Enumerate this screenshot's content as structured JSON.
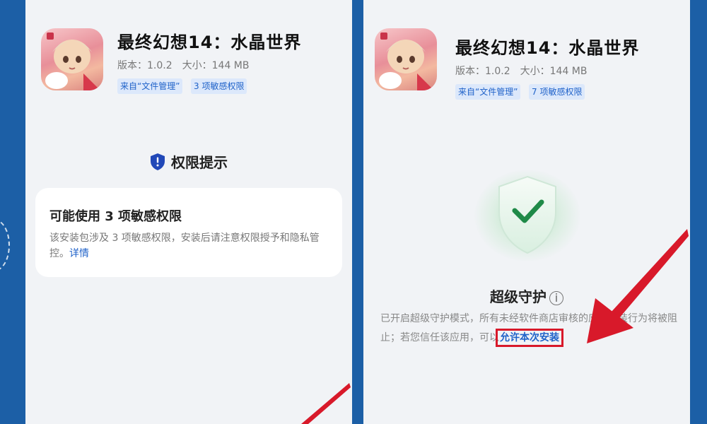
{
  "app": {
    "name": "最终幻想14：水晶世界",
    "version": "版本：1.0.2",
    "size": "大小：144 MB"
  },
  "left_screen": {
    "tag_source": "来自“文件管理”",
    "tag_permissions": "3 项敏感权限",
    "permission_heading": "权限提示",
    "card_title": "可能使用 3 项敏感权限",
    "card_desc": "该安装包涉及 3 项敏感权限，安装后请注意权限授予和隐私管控。",
    "card_link": "详情"
  },
  "right_screen": {
    "tag_source": "来自“文件管理”",
    "tag_permissions": "7 项敏感权限",
    "guard_title": "超级守护",
    "guard_info_icon": "i",
    "guard_desc": "已开启超级守护模式，所有未经软件商店审核的应用安装行为将被阻止；若您信任该应用，可以",
    "allow_link": "允许本次安装"
  },
  "colors": {
    "link_blue": "#1f62c9",
    "annotation_red": "#d8192a",
    "shield_green": "#1f8a48",
    "frame_blue": "#1c5fa6"
  },
  "icons": [
    "app-icon",
    "shield-icon",
    "shield-check-icon",
    "info-icon",
    "red-arrow-icon"
  ]
}
